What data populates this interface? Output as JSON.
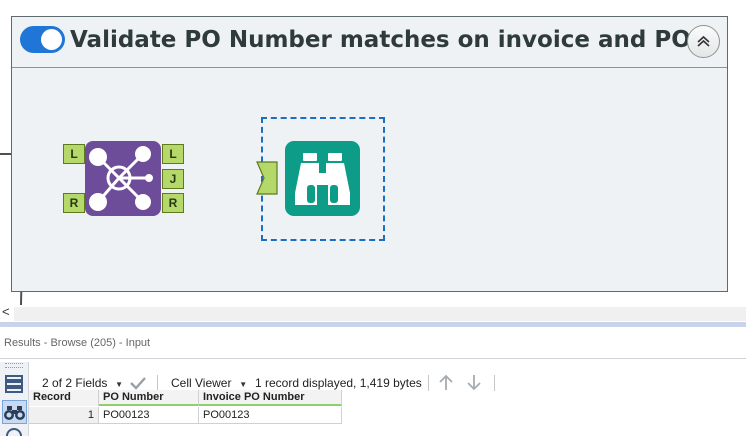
{
  "workflow": {
    "container_title": "Validate PO Number matches on invoice and PO",
    "toggle_enabled": true,
    "join_tool": {
      "input_anchors": [
        "L",
        "R"
      ],
      "output_anchors": [
        "L",
        "J",
        "R"
      ],
      "icon": "join-icon"
    },
    "browse_tool": {
      "icon": "binoculars-icon",
      "selected": true
    },
    "scroll_left_glyph": "<"
  },
  "results": {
    "title": "Results - Browse (205) - Input",
    "fields_label": "2 of 2 Fields",
    "cell_viewer_label": "Cell Viewer",
    "record_summary": "1 record displayed, 1,419 bytes",
    "columns": [
      "Record",
      "PO Number",
      "Invoice PO Number"
    ],
    "rows": [
      [
        "1",
        "PO00123",
        "PO00123"
      ]
    ]
  },
  "colors": {
    "container_bg": "#eff2f4",
    "toggle_on": "#1f76d6",
    "join_purple": "#6d4c99",
    "browse_teal": "#0d9c87",
    "anchor_green": "#b4d86a",
    "connection_blue": "#1a2dbf",
    "selection_dash": "#1a6fc4"
  }
}
